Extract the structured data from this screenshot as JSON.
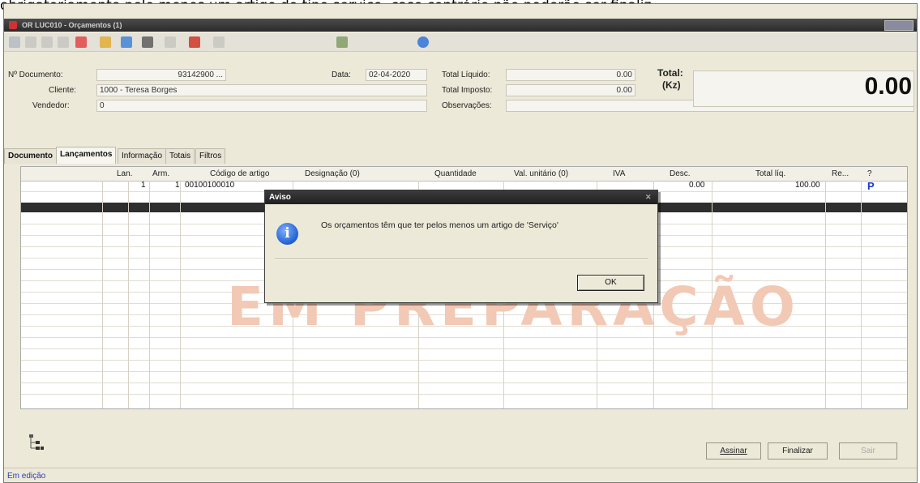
{
  "caption_text": "obrigatoriamente pelo menos um artigo do tipo serviço, caso contrário não poderão ser finaliz",
  "window": {
    "title": "OR LUC010 - Orçamentos (1)"
  },
  "header": {
    "doc_label": "Nº Documento:",
    "doc_value": "93142900 ...",
    "cliente_label": "Cliente:",
    "cliente_value": "1000 - Teresa Borges",
    "vendedor_label": "Vendedor:",
    "vendedor_value": "0",
    "data_label": "Data:",
    "data_value": "02-04-2020",
    "total_liquido_label": "Total Líquido:",
    "total_liquido_value": "0.00",
    "total_imposto_label": "Total Imposto:",
    "total_imposto_value": "0.00",
    "observacoes_label": "Observações:",
    "total_label": "Total:",
    "total_currency": "(Kz)",
    "total_value": "0.00"
  },
  "tabs": [
    "Documento",
    "Lançamentos",
    "Informação",
    "Totais",
    "Filtros"
  ],
  "grid": {
    "columns": [
      "Lan.",
      "Arm.",
      "Código de artigo",
      "Designação (0)",
      "Quantidade",
      "Val. unitário (0)",
      "IVA",
      "Desc.",
      "Total líq.",
      "Re...",
      "?"
    ],
    "row": {
      "lan": "1",
      "arm": "1",
      "codigo": "00100100010",
      "desc": "0.00",
      "total": "100.00",
      "flag": "P"
    }
  },
  "watermark": "EM PREPARAÇÃO",
  "dialog": {
    "title": "Aviso",
    "message": "Os orçamentos têm que ter pelos menos um artigo de 'Serviço'",
    "ok_label": "OK"
  },
  "buttons": {
    "assinar": "Assinar",
    "finalizar": "Finalizar",
    "sair": "Sair"
  },
  "status": "Em edição"
}
